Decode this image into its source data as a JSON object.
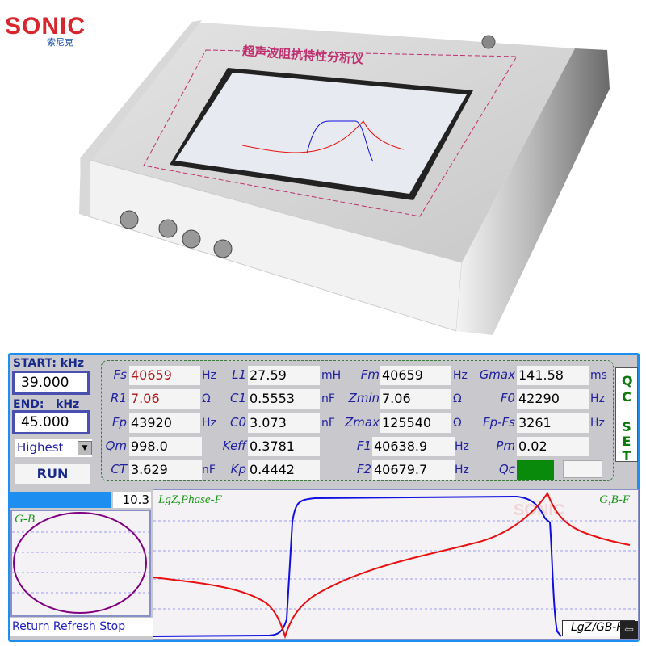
{
  "brand": {
    "logo_text": "SONIC",
    "logo_cn": "索尼克"
  },
  "device": {
    "title_cn": "超声波阻抗特性分析仪"
  },
  "sweep": {
    "start_label": "START: kHz",
    "start_value": "39.000",
    "end_label": "END:   kHz",
    "end_value": "45.000",
    "precision": "Highest",
    "run_label": "RUN"
  },
  "params": [
    [
      {
        "l": "Fs",
        "v": "40659",
        "u": "Hz",
        "red": true
      },
      {
        "l": "L1",
        "v": "27.59",
        "u": "mH"
      },
      {
        "l": "Fm",
        "v": "40659",
        "u": "Hz"
      },
      {
        "l": "Gmax",
        "v": "141.58",
        "u": "ms"
      }
    ],
    [
      {
        "l": "R1",
        "v": "7.06",
        "u": "Ω",
        "red": true
      },
      {
        "l": "C1",
        "v": "0.5553",
        "u": "nF"
      },
      {
        "l": "Zmin",
        "v": "7.06",
        "u": "Ω"
      },
      {
        "l": "F0",
        "v": "42290",
        "u": "Hz"
      }
    ],
    [
      {
        "l": "Fp",
        "v": "43920",
        "u": "Hz"
      },
      {
        "l": "C0",
        "v": "3.073",
        "u": "nF"
      },
      {
        "l": "Zmax",
        "v": "125540",
        "u": "Ω"
      },
      {
        "l": "Fp-Fs",
        "v": "3261",
        "u": "Hz"
      }
    ],
    [
      {
        "l": "Qm",
        "v": "998.0",
        "u": ""
      },
      {
        "l": "Keff",
        "v": "0.3781",
        "u": ""
      },
      {
        "l": "F1",
        "v": "40638.9",
        "u": "Hz"
      },
      {
        "l": "Pm",
        "v": "0.02",
        "u": ""
      }
    ],
    [
      {
        "l": "CT",
        "v": "3.629",
        "u": "nF"
      },
      {
        "l": "Kp",
        "v": "0.4442",
        "u": ""
      },
      {
        "l": "F2",
        "v": "40679.7",
        "u": "Hz"
      },
      {
        "l": "Qc",
        "v": "",
        "u": ""
      }
    ]
  ],
  "qc_set": {
    "label1": "Q C",
    "label2": "S E T"
  },
  "qc_status_color": "#0a8a0a",
  "progress": {
    "value": "10.3",
    "fill": 1.0
  },
  "gb_plot": {
    "title": "G-B"
  },
  "main_plot": {
    "left_title": "LgZ,Phase-F",
    "right_title": "G,B-F",
    "toggle_label": "LgZ/GB-F",
    "watermark": "SONIC"
  },
  "nav": {
    "return": "Return",
    "refresh": "Refresh",
    "stop": "Stop"
  },
  "colors": {
    "accent": "#1e8ef0",
    "phase": "#1010e0",
    "lgz": "#e81010",
    "gb": "#800080"
  }
}
